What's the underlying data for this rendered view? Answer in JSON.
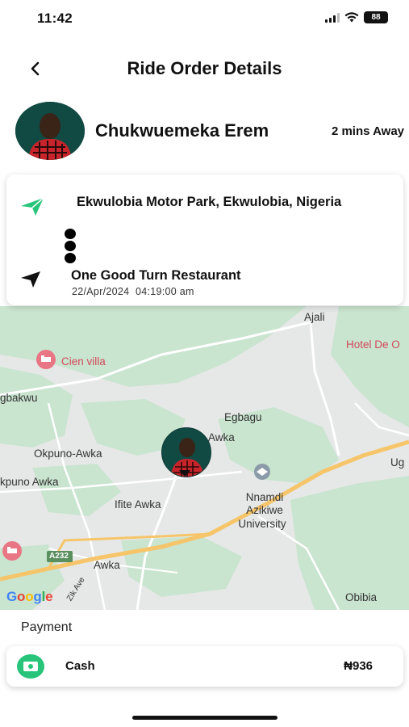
{
  "status_bar": {
    "time": "11:42",
    "battery": "88",
    "icons": [
      "cellular-signal-icon",
      "wifi-icon",
      "battery-icon"
    ]
  },
  "header": {
    "title": "Ride Order Details",
    "back_icon": "chevron-left-icon"
  },
  "driver": {
    "name": "Chukwuemeka Erem",
    "eta": "2 mins Away"
  },
  "route": {
    "pickup": "Ekwulobia Motor Park, Ekwulobia, Nigeria",
    "dropoff": "One Good Turn Restaurant",
    "date": "22/Apr/2024",
    "time": "04:19:00 am"
  },
  "map": {
    "labels": {
      "ajali": "Ajali",
      "hotel": "Hotel De O",
      "cien_villa": "Cien villa",
      "gbakwu": "gbakwu",
      "egbagu": "Egbagu",
      "awka_pin": "Awka",
      "okpuno_awka": "Okpuno-Awka",
      "kpuno_awka": "kpuno Awka",
      "nnamdi": "Nnamdi",
      "azikiwe": "Azikiwe",
      "university": "University",
      "ifite_awka": "Ifite Awka",
      "ug": "Ug",
      "a232": "A232",
      "awka": "Awka",
      "zik_ave": "Zik Ave",
      "obibia": "Obibia"
    },
    "attribution": "Google",
    "colors": {
      "land": "#e6e8e7",
      "green": "#c9e4cf",
      "road": "#f6c56a",
      "poi": "#d24a5b"
    }
  },
  "payment": {
    "label": "Payment",
    "method": "Cash",
    "amount": "₦936",
    "accent": "#27c47a"
  }
}
